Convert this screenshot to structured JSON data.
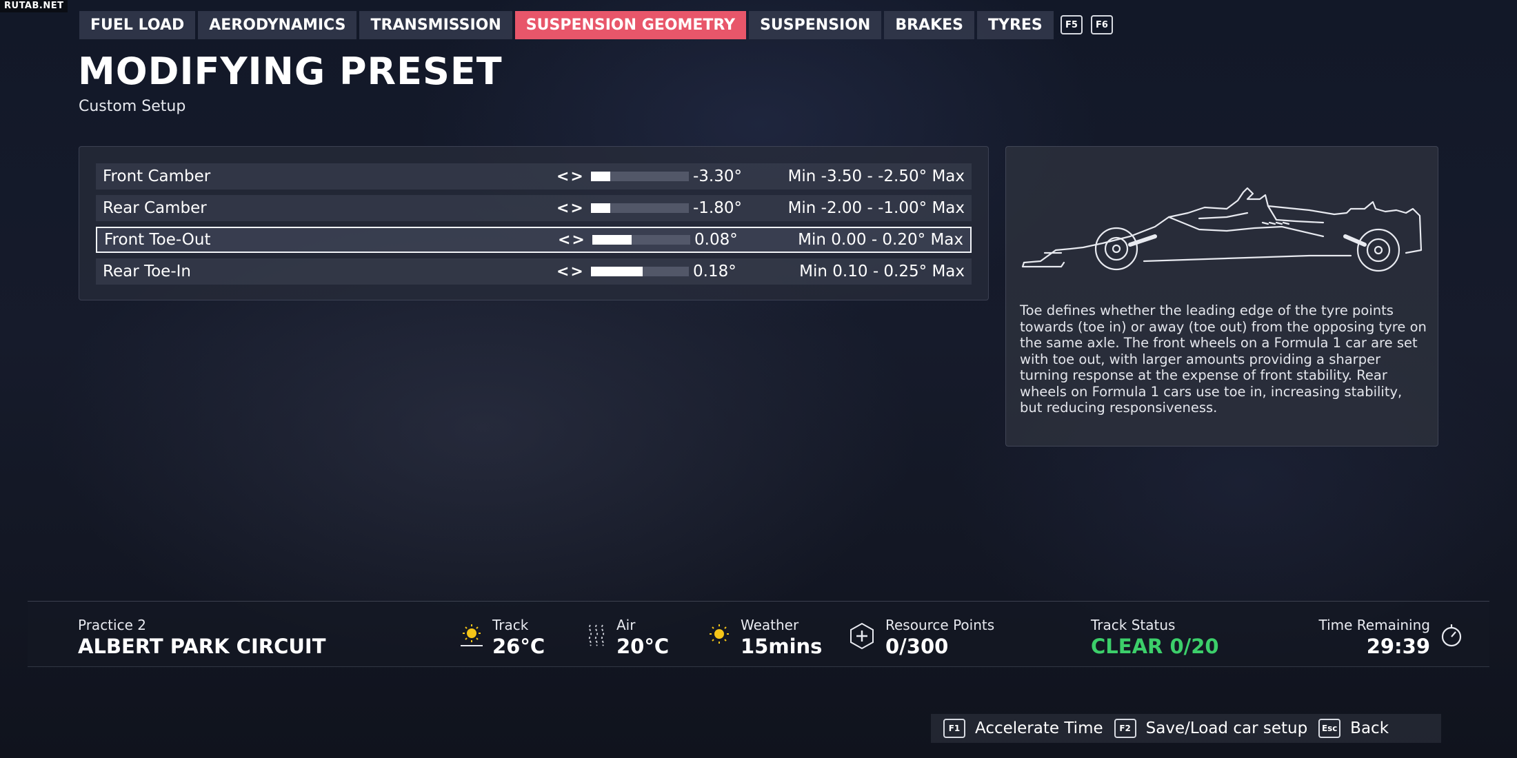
{
  "watermark": "RUTAB.NET",
  "tabs": [
    {
      "label": "FUEL LOAD"
    },
    {
      "label": "AERODYNAMICS"
    },
    {
      "label": "TRANSMISSION"
    },
    {
      "label": "SUSPENSION GEOMETRY",
      "active": true
    },
    {
      "label": "SUSPENSION"
    },
    {
      "label": "BRAKES"
    },
    {
      "label": "TYRES"
    }
  ],
  "tab_keys": [
    "F5",
    "F6"
  ],
  "header": {
    "title": "MODIFYING PRESET",
    "subtitle": "Custom Setup"
  },
  "settings": [
    {
      "label": "Front Camber",
      "value": "-3.30°",
      "range": "Min -3.50 - -2.50° Max",
      "fill_fraction": 0.2,
      "selected": false
    },
    {
      "label": "Rear Camber",
      "value": "-1.80°",
      "range": "Min -2.00 - -1.00° Max",
      "fill_fraction": 0.2,
      "selected": false
    },
    {
      "label": "Front Toe-Out",
      "value": "0.08°",
      "range": "Min 0.00 - 0.20° Max",
      "fill_fraction": 0.4,
      "selected": true
    },
    {
      "label": "Rear Toe-In",
      "value": "0.18°",
      "range": "Min 0.10 - 0.25° Max",
      "fill_fraction": 0.53,
      "selected": false
    }
  ],
  "info": {
    "description": "Toe defines whether the leading edge of the tyre points towards (toe in) or away (toe out) from the opposing tyre on the same axle. The front wheels on a Formula 1 car are set with toe out, with larger amounts providing a sharper turning response at the expense of front stability. Rear wheels on Formula 1 cars use toe in, increasing stability, but reducing responsiveness."
  },
  "status": {
    "session_label": "Practice 2",
    "circuit": "ALBERT PARK CIRCUIT",
    "track_label": "Track",
    "track_temp": "26°C",
    "air_label": "Air",
    "air_temp": "20°C",
    "weather_label": "Weather",
    "weather_value": "15mins",
    "resource_label": "Resource Points",
    "resource_value": "0/300",
    "track_status_label": "Track Status",
    "track_status_value": "CLEAR 0/20",
    "time_label": "Time Remaining",
    "time_value": "29:39",
    "status_color": "#3ccf6a"
  },
  "footer": [
    {
      "key": "F1",
      "label": "Accelerate Time"
    },
    {
      "key": "F2",
      "label": "Save/Load car setup"
    },
    {
      "key": "Esc",
      "label": "Back"
    }
  ]
}
